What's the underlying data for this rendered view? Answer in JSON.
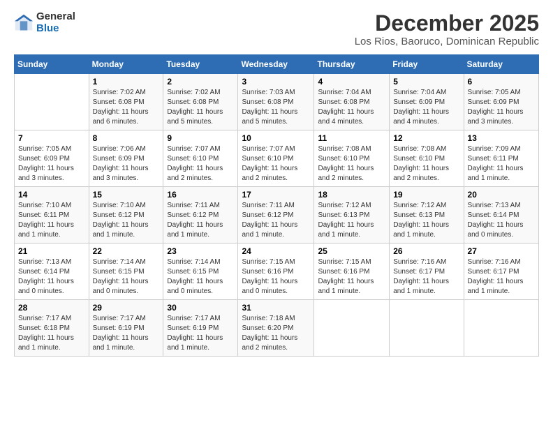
{
  "logo": {
    "general": "General",
    "blue": "Blue"
  },
  "title": "December 2025",
  "subtitle": "Los Rios, Baoruco, Dominican Republic",
  "headers": [
    "Sunday",
    "Monday",
    "Tuesday",
    "Wednesday",
    "Thursday",
    "Friday",
    "Saturday"
  ],
  "weeks": [
    [
      {
        "num": "",
        "info": ""
      },
      {
        "num": "1",
        "info": "Sunrise: 7:02 AM\nSunset: 6:08 PM\nDaylight: 11 hours and 6 minutes."
      },
      {
        "num": "2",
        "info": "Sunrise: 7:02 AM\nSunset: 6:08 PM\nDaylight: 11 hours and 5 minutes."
      },
      {
        "num": "3",
        "info": "Sunrise: 7:03 AM\nSunset: 6:08 PM\nDaylight: 11 hours and 5 minutes."
      },
      {
        "num": "4",
        "info": "Sunrise: 7:04 AM\nSunset: 6:08 PM\nDaylight: 11 hours and 4 minutes."
      },
      {
        "num": "5",
        "info": "Sunrise: 7:04 AM\nSunset: 6:09 PM\nDaylight: 11 hours and 4 minutes."
      },
      {
        "num": "6",
        "info": "Sunrise: 7:05 AM\nSunset: 6:09 PM\nDaylight: 11 hours and 3 minutes."
      }
    ],
    [
      {
        "num": "7",
        "info": "Sunrise: 7:05 AM\nSunset: 6:09 PM\nDaylight: 11 hours and 3 minutes."
      },
      {
        "num": "8",
        "info": "Sunrise: 7:06 AM\nSunset: 6:09 PM\nDaylight: 11 hours and 3 minutes."
      },
      {
        "num": "9",
        "info": "Sunrise: 7:07 AM\nSunset: 6:10 PM\nDaylight: 11 hours and 2 minutes."
      },
      {
        "num": "10",
        "info": "Sunrise: 7:07 AM\nSunset: 6:10 PM\nDaylight: 11 hours and 2 minutes."
      },
      {
        "num": "11",
        "info": "Sunrise: 7:08 AM\nSunset: 6:10 PM\nDaylight: 11 hours and 2 minutes."
      },
      {
        "num": "12",
        "info": "Sunrise: 7:08 AM\nSunset: 6:10 PM\nDaylight: 11 hours and 2 minutes."
      },
      {
        "num": "13",
        "info": "Sunrise: 7:09 AM\nSunset: 6:11 PM\nDaylight: 11 hours and 1 minute."
      }
    ],
    [
      {
        "num": "14",
        "info": "Sunrise: 7:10 AM\nSunset: 6:11 PM\nDaylight: 11 hours and 1 minute."
      },
      {
        "num": "15",
        "info": "Sunrise: 7:10 AM\nSunset: 6:12 PM\nDaylight: 11 hours and 1 minute."
      },
      {
        "num": "16",
        "info": "Sunrise: 7:11 AM\nSunset: 6:12 PM\nDaylight: 11 hours and 1 minute."
      },
      {
        "num": "17",
        "info": "Sunrise: 7:11 AM\nSunset: 6:12 PM\nDaylight: 11 hours and 1 minute."
      },
      {
        "num": "18",
        "info": "Sunrise: 7:12 AM\nSunset: 6:13 PM\nDaylight: 11 hours and 1 minute."
      },
      {
        "num": "19",
        "info": "Sunrise: 7:12 AM\nSunset: 6:13 PM\nDaylight: 11 hours and 1 minute."
      },
      {
        "num": "20",
        "info": "Sunrise: 7:13 AM\nSunset: 6:14 PM\nDaylight: 11 hours and 0 minutes."
      }
    ],
    [
      {
        "num": "21",
        "info": "Sunrise: 7:13 AM\nSunset: 6:14 PM\nDaylight: 11 hours and 0 minutes."
      },
      {
        "num": "22",
        "info": "Sunrise: 7:14 AM\nSunset: 6:15 PM\nDaylight: 11 hours and 0 minutes."
      },
      {
        "num": "23",
        "info": "Sunrise: 7:14 AM\nSunset: 6:15 PM\nDaylight: 11 hours and 0 minutes."
      },
      {
        "num": "24",
        "info": "Sunrise: 7:15 AM\nSunset: 6:16 PM\nDaylight: 11 hours and 0 minutes."
      },
      {
        "num": "25",
        "info": "Sunrise: 7:15 AM\nSunset: 6:16 PM\nDaylight: 11 hours and 1 minute."
      },
      {
        "num": "26",
        "info": "Sunrise: 7:16 AM\nSunset: 6:17 PM\nDaylight: 11 hours and 1 minute."
      },
      {
        "num": "27",
        "info": "Sunrise: 7:16 AM\nSunset: 6:17 PM\nDaylight: 11 hours and 1 minute."
      }
    ],
    [
      {
        "num": "28",
        "info": "Sunrise: 7:17 AM\nSunset: 6:18 PM\nDaylight: 11 hours and 1 minute."
      },
      {
        "num": "29",
        "info": "Sunrise: 7:17 AM\nSunset: 6:19 PM\nDaylight: 11 hours and 1 minute."
      },
      {
        "num": "30",
        "info": "Sunrise: 7:17 AM\nSunset: 6:19 PM\nDaylight: 11 hours and 1 minute."
      },
      {
        "num": "31",
        "info": "Sunrise: 7:18 AM\nSunset: 6:20 PM\nDaylight: 11 hours and 2 minutes."
      },
      {
        "num": "",
        "info": ""
      },
      {
        "num": "",
        "info": ""
      },
      {
        "num": "",
        "info": ""
      }
    ]
  ]
}
